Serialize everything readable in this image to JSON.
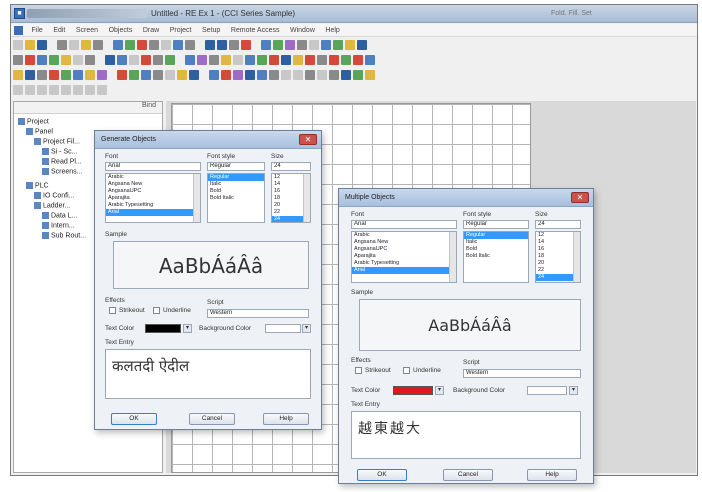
{
  "titlebar": {
    "title": "Untitled - RE Ex 1 - (CCI Series Sample)",
    "right_text": "Fold. Fill. Set"
  },
  "menubar": {
    "items": [
      "File",
      "Edit",
      "Screen",
      "Objects",
      "Draw",
      "Project",
      "Setup",
      "Remote Access",
      "Window",
      "Help"
    ]
  },
  "sidebar": {
    "header": "Bind",
    "tree": [
      {
        "label": "Project"
      },
      {
        "label": "Panel"
      },
      {
        "label": "Project Fil..."
      },
      {
        "label": "Si - Sc..."
      },
      {
        "label": "Read Pl..."
      },
      {
        "label": "Screens..."
      },
      {
        "label": "PLC"
      },
      {
        "label": "IO Confi..."
      },
      {
        "label": "Ladder..."
      },
      {
        "label": "Data L..."
      },
      {
        "label": "Intern..."
      },
      {
        "label": "Sub Rout..."
      }
    ]
  },
  "dialog1": {
    "caption": "Generate Objects",
    "font_label": "Font",
    "font_value": "Arial",
    "style_label": "Font style",
    "style_value": "Regular",
    "size_label": "Size",
    "size_value": "24",
    "font_list": [
      "Arabic",
      "Angsana New",
      "AngsanaUPC",
      "Aparajita",
      "Arabic Typesetting",
      "Arial"
    ],
    "style_list": [
      "Regular",
      "Italic",
      "Bold",
      "Bold Italic"
    ],
    "size_list": [
      "12",
      "14",
      "16",
      "18",
      "20",
      "22",
      "24"
    ],
    "sample_label": "Sample",
    "sample_text": "AaBbÁáÂâ",
    "effects_label": "Effects",
    "strikeout_label": "Strikeout",
    "underline_label": "Underline",
    "script_label": "Script",
    "script_value": "Western",
    "text_color_label": "Text Color",
    "text_color": "#000000",
    "background_label": "Background Color",
    "text_entry_label": "Text Entry",
    "entry_text": "कलतदी ऐदील",
    "ok_label": "OK",
    "cancel_label": "Cancel",
    "help_label": "Help"
  },
  "dialog2": {
    "caption": "Multiple Objects",
    "font_label": "Font",
    "font_value": "Arial",
    "style_label": "Font style",
    "style_value": "Regular",
    "size_label": "Size",
    "size_value": "24",
    "font_list": [
      "Arabic",
      "Angsana New",
      "AngsanaUPC",
      "Aparajita",
      "Arabic Typesetting",
      "Arial"
    ],
    "style_list": [
      "Regular",
      "Italic",
      "Bold",
      "Bold Italic"
    ],
    "size_list": [
      "12",
      "14",
      "16",
      "18",
      "20",
      "22",
      "24"
    ],
    "sample_label": "Sample",
    "sample_text": "AaBbÁáÂâ",
    "effects_label": "Effects",
    "strikeout_label": "Strikeout",
    "underline_label": "Underline",
    "script_label": "Script",
    "script_value": "Western",
    "text_color_label": "Text Color",
    "text_color": "#e01818",
    "background_label": "Background Color",
    "text_entry_label": "Text Entry",
    "entry_text": "越東越大",
    "ok_label": "OK",
    "cancel_label": "Cancel",
    "help_label": "Help"
  },
  "colors": {
    "selection": "#3399ff",
    "titlebar": "#a9bcd4",
    "workspace": "#d9d9d9"
  }
}
